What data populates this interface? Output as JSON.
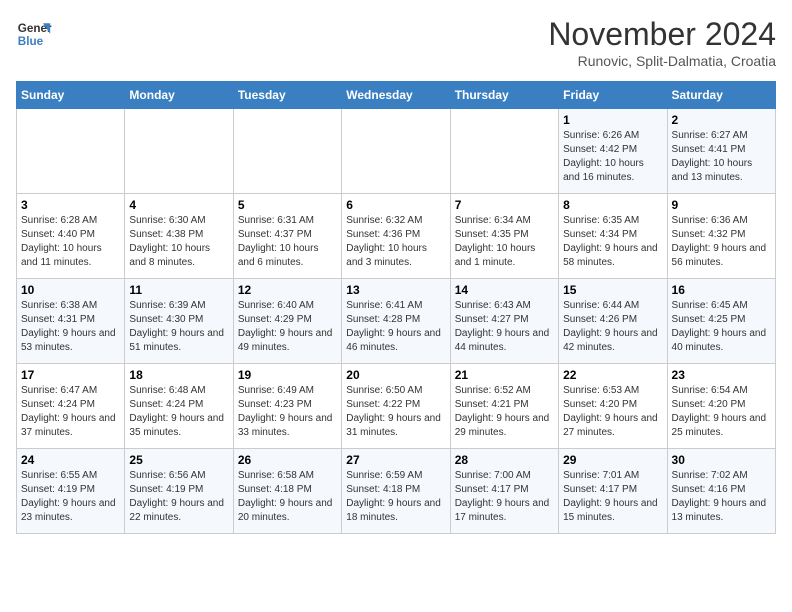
{
  "logo": {
    "line1": "General",
    "line2": "Blue"
  },
  "title": "November 2024",
  "subtitle": "Runovic, Split-Dalmatia, Croatia",
  "weekdays": [
    "Sunday",
    "Monday",
    "Tuesday",
    "Wednesday",
    "Thursday",
    "Friday",
    "Saturday"
  ],
  "weeks": [
    [
      {
        "day": "",
        "info": ""
      },
      {
        "day": "",
        "info": ""
      },
      {
        "day": "",
        "info": ""
      },
      {
        "day": "",
        "info": ""
      },
      {
        "day": "",
        "info": ""
      },
      {
        "day": "1",
        "info": "Sunrise: 6:26 AM\nSunset: 4:42 PM\nDaylight: 10 hours and 16 minutes."
      },
      {
        "day": "2",
        "info": "Sunrise: 6:27 AM\nSunset: 4:41 PM\nDaylight: 10 hours and 13 minutes."
      }
    ],
    [
      {
        "day": "3",
        "info": "Sunrise: 6:28 AM\nSunset: 4:40 PM\nDaylight: 10 hours and 11 minutes."
      },
      {
        "day": "4",
        "info": "Sunrise: 6:30 AM\nSunset: 4:38 PM\nDaylight: 10 hours and 8 minutes."
      },
      {
        "day": "5",
        "info": "Sunrise: 6:31 AM\nSunset: 4:37 PM\nDaylight: 10 hours and 6 minutes."
      },
      {
        "day": "6",
        "info": "Sunrise: 6:32 AM\nSunset: 4:36 PM\nDaylight: 10 hours and 3 minutes."
      },
      {
        "day": "7",
        "info": "Sunrise: 6:34 AM\nSunset: 4:35 PM\nDaylight: 10 hours and 1 minute."
      },
      {
        "day": "8",
        "info": "Sunrise: 6:35 AM\nSunset: 4:34 PM\nDaylight: 9 hours and 58 minutes."
      },
      {
        "day": "9",
        "info": "Sunrise: 6:36 AM\nSunset: 4:32 PM\nDaylight: 9 hours and 56 minutes."
      }
    ],
    [
      {
        "day": "10",
        "info": "Sunrise: 6:38 AM\nSunset: 4:31 PM\nDaylight: 9 hours and 53 minutes."
      },
      {
        "day": "11",
        "info": "Sunrise: 6:39 AM\nSunset: 4:30 PM\nDaylight: 9 hours and 51 minutes."
      },
      {
        "day": "12",
        "info": "Sunrise: 6:40 AM\nSunset: 4:29 PM\nDaylight: 9 hours and 49 minutes."
      },
      {
        "day": "13",
        "info": "Sunrise: 6:41 AM\nSunset: 4:28 PM\nDaylight: 9 hours and 46 minutes."
      },
      {
        "day": "14",
        "info": "Sunrise: 6:43 AM\nSunset: 4:27 PM\nDaylight: 9 hours and 44 minutes."
      },
      {
        "day": "15",
        "info": "Sunrise: 6:44 AM\nSunset: 4:26 PM\nDaylight: 9 hours and 42 minutes."
      },
      {
        "day": "16",
        "info": "Sunrise: 6:45 AM\nSunset: 4:25 PM\nDaylight: 9 hours and 40 minutes."
      }
    ],
    [
      {
        "day": "17",
        "info": "Sunrise: 6:47 AM\nSunset: 4:24 PM\nDaylight: 9 hours and 37 minutes."
      },
      {
        "day": "18",
        "info": "Sunrise: 6:48 AM\nSunset: 4:24 PM\nDaylight: 9 hours and 35 minutes."
      },
      {
        "day": "19",
        "info": "Sunrise: 6:49 AM\nSunset: 4:23 PM\nDaylight: 9 hours and 33 minutes."
      },
      {
        "day": "20",
        "info": "Sunrise: 6:50 AM\nSunset: 4:22 PM\nDaylight: 9 hours and 31 minutes."
      },
      {
        "day": "21",
        "info": "Sunrise: 6:52 AM\nSunset: 4:21 PM\nDaylight: 9 hours and 29 minutes."
      },
      {
        "day": "22",
        "info": "Sunrise: 6:53 AM\nSunset: 4:20 PM\nDaylight: 9 hours and 27 minutes."
      },
      {
        "day": "23",
        "info": "Sunrise: 6:54 AM\nSunset: 4:20 PM\nDaylight: 9 hours and 25 minutes."
      }
    ],
    [
      {
        "day": "24",
        "info": "Sunrise: 6:55 AM\nSunset: 4:19 PM\nDaylight: 9 hours and 23 minutes."
      },
      {
        "day": "25",
        "info": "Sunrise: 6:56 AM\nSunset: 4:19 PM\nDaylight: 9 hours and 22 minutes."
      },
      {
        "day": "26",
        "info": "Sunrise: 6:58 AM\nSunset: 4:18 PM\nDaylight: 9 hours and 20 minutes."
      },
      {
        "day": "27",
        "info": "Sunrise: 6:59 AM\nSunset: 4:18 PM\nDaylight: 9 hours and 18 minutes."
      },
      {
        "day": "28",
        "info": "Sunrise: 7:00 AM\nSunset: 4:17 PM\nDaylight: 9 hours and 17 minutes."
      },
      {
        "day": "29",
        "info": "Sunrise: 7:01 AM\nSunset: 4:17 PM\nDaylight: 9 hours and 15 minutes."
      },
      {
        "day": "30",
        "info": "Sunrise: 7:02 AM\nSunset: 4:16 PM\nDaylight: 9 hours and 13 minutes."
      }
    ]
  ]
}
